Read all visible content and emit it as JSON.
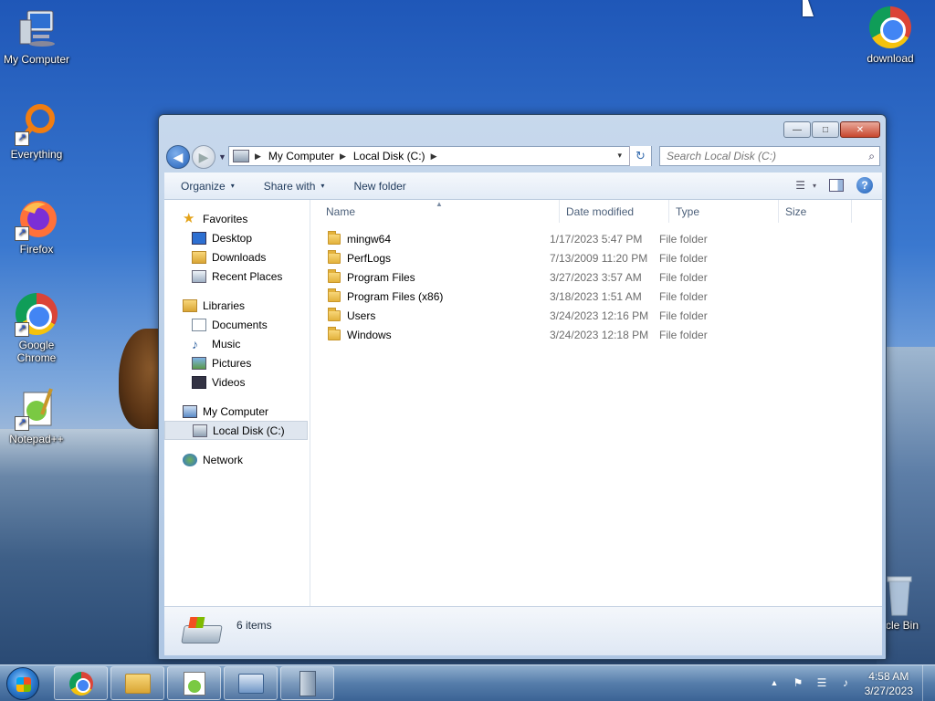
{
  "desktop": {
    "icons": [
      {
        "label": "My Computer",
        "icon": "computer-icon"
      },
      {
        "label": "Everything",
        "icon": "everything-search-icon"
      },
      {
        "label": "Firefox",
        "icon": "firefox-icon"
      },
      {
        "label": "Google Chrome",
        "icon": "chrome-icon"
      },
      {
        "label": "Notepad++",
        "icon": "notepadpp-icon"
      },
      {
        "label": "download",
        "icon": "chrome-icon"
      },
      {
        "label": "cle Bin",
        "icon": "recycle-bin-icon"
      }
    ]
  },
  "window": {
    "controls": {
      "minimize": "—",
      "maximize": "□",
      "close": "✕"
    },
    "address": {
      "crumbs": [
        "My Computer",
        "Local Disk (C:)"
      ],
      "drop": "▾",
      "refresh": "↻"
    },
    "search": {
      "placeholder": "Search Local Disk (C:)",
      "icon": "⌕"
    },
    "toolbar": {
      "organize": "Organize",
      "share_with": "Share with",
      "new_folder": "New folder",
      "caret": "▾",
      "help": "?"
    },
    "nav_pane": {
      "favorites": {
        "label": "Favorites",
        "items": [
          "Desktop",
          "Downloads",
          "Recent Places"
        ]
      },
      "libraries": {
        "label": "Libraries",
        "items": [
          "Documents",
          "Music",
          "Pictures",
          "Videos"
        ]
      },
      "computer": {
        "label": "My Computer",
        "items": [
          "Local Disk (C:)"
        ]
      },
      "network": {
        "label": "Network"
      }
    },
    "columns": {
      "name": "Name",
      "date": "Date modified",
      "type": "Type",
      "size": "Size",
      "sort_arrow": "▲"
    },
    "files": [
      {
        "name": "mingw64",
        "date": "1/17/2023 5:47 PM",
        "type": "File folder"
      },
      {
        "name": "PerfLogs",
        "date": "7/13/2009 11:20 PM",
        "type": "File folder"
      },
      {
        "name": "Program Files",
        "date": "3/27/2023 3:57 AM",
        "type": "File folder"
      },
      {
        "name": "Program Files (x86)",
        "date": "3/18/2023 1:51 AM",
        "type": "File folder"
      },
      {
        "name": "Users",
        "date": "3/24/2023 12:16 PM",
        "type": "File folder"
      },
      {
        "name": "Windows",
        "date": "3/24/2023 12:18 PM",
        "type": "File folder"
      }
    ],
    "status": {
      "items_count": "6 items"
    }
  },
  "taskbar": {
    "buttons": [
      "chrome-icon",
      "explorer-icon",
      "notepadpp-icon",
      "remote-desktop-icon",
      "server-icon"
    ],
    "tray": {
      "show_hidden": "▲",
      "flag": "⚑",
      "network": "☰",
      "volume": "♪"
    },
    "clock": {
      "time": "4:58 AM",
      "date": "3/27/2023"
    }
  }
}
